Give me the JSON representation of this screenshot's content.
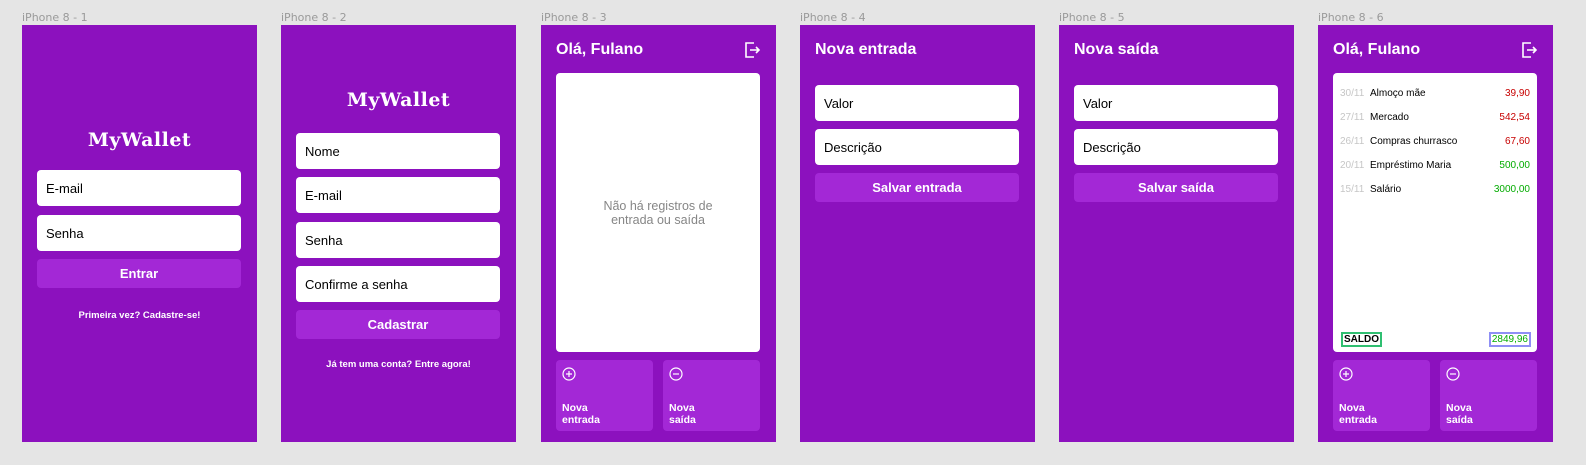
{
  "colors": {
    "background": "#e5e5e5",
    "primary": "#8c11be",
    "button": "#a328d6",
    "positive": "#03ac00",
    "negative": "#c70000",
    "muted_date": "#c6c6c6",
    "empty_text": "#868686"
  },
  "frames": [
    {
      "label": "iPhone 8 - 1"
    },
    {
      "label": "iPhone 8 - 2"
    },
    {
      "label": "iPhone 8 - 3"
    },
    {
      "label": "iPhone 8 - 4"
    },
    {
      "label": "iPhone 8 - 5"
    },
    {
      "label": "iPhone 8 - 6"
    }
  ],
  "login": {
    "logo": "MyWallet",
    "email_placeholder": "E-mail",
    "password_placeholder": "Senha",
    "submit_label": "Entrar",
    "signup_link": "Primeira vez? Cadastre-se!"
  },
  "signup": {
    "logo": "MyWallet",
    "name_placeholder": "Nome",
    "email_placeholder": "E-mail",
    "password_placeholder": "Senha",
    "confirm_placeholder": "Confirme a senha",
    "submit_label": "Cadastrar",
    "login_link": "Já tem uma conta? Entre agora!"
  },
  "home_empty": {
    "title": "Olá, Fulano",
    "logout_icon": "logout-icon",
    "empty_message_line1": "Não há registros de",
    "empty_message_line2": "entrada ou saída",
    "new_entry_line1": "Nova",
    "new_entry_line2": "entrada",
    "new_exit_line1": "Nova",
    "new_exit_line2": "saída"
  },
  "new_entry": {
    "title": "Nova entrada",
    "value_placeholder": "Valor",
    "description_placeholder": "Descrição",
    "submit_label": "Salvar entrada"
  },
  "new_exit": {
    "title": "Nova saída",
    "value_placeholder": "Valor",
    "description_placeholder": "Descrição",
    "submit_label": "Salvar saída"
  },
  "home_records": {
    "title": "Olá, Fulano",
    "records": [
      {
        "date": "30/11",
        "description": "Almoço mãe",
        "value": "39,90",
        "type": "negative"
      },
      {
        "date": "27/11",
        "description": "Mercado",
        "value": "542,54",
        "type": "negative"
      },
      {
        "date": "26/11",
        "description": "Compras churrasco",
        "value": "67,60",
        "type": "negative"
      },
      {
        "date": "20/11",
        "description": "Empréstimo Maria",
        "value": "500,00",
        "type": "positive"
      },
      {
        "date": "15/11",
        "description": "Salário",
        "value": "3000,00",
        "type": "positive"
      }
    ],
    "balance_label": "SALDO",
    "balance_value": "2849,96",
    "new_entry_line1": "Nova",
    "new_entry_line2": "entrada",
    "new_exit_line1": "Nova",
    "new_exit_line2": "saída"
  }
}
